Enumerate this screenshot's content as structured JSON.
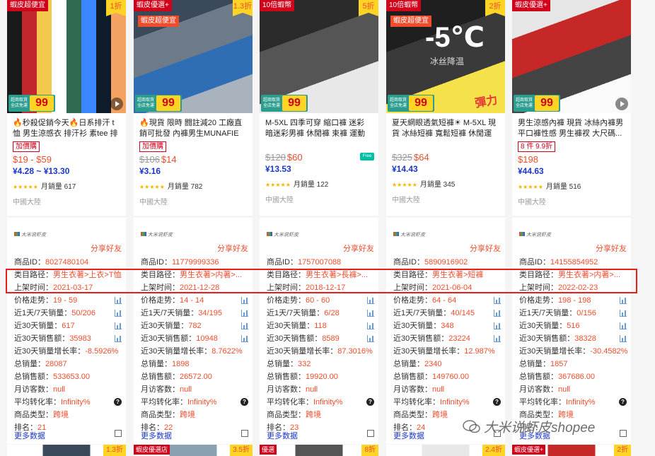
{
  "products": [
    {
      "tag": "蝦皮超便宜",
      "tag2": "",
      "discount": "1折",
      "title": "🔥秒殺促銷今天🔥日系排汗 t恤 男生涼感衣 排汗衫 素tee 排汗...",
      "badge": "加價購",
      "old_price": "",
      "price": "$19 - $59",
      "cny": "¥4.28 ~ ¥13.30",
      "sales": "月銷量 617",
      "origin": "中國大陸",
      "promo_label": "超商取貨 全店免運",
      "promo_num": "99",
      "play": true,
      "free": false,
      "thumb_colors": [
        "#1a1a1a",
        "#c1272d",
        "#f2c94c",
        "#ffffff",
        "#2d6a4f",
        "#3a86ff",
        "#0d1b2a",
        "#f4a261"
      ]
    },
    {
      "tag": "蝦皮優選+",
      "tag2": "蝦皮超便宜",
      "discount": "1.3折",
      "title": "🔥現貨 限時 闘註減20 工廠直銷可批發 內褲男生MUNAFIE凶...",
      "badge": "加價購",
      "old_price": "$106",
      "price": "$14",
      "cny": "¥3.16",
      "sales": "月銷量 782",
      "origin": "中國大陸",
      "promo_label": "超商取貨 全店免運",
      "promo_num": "99",
      "play": false,
      "free": false,
      "thumb_colors": [
        "#3b4a5a",
        "#6c7a89",
        "#2f6db5",
        "#a8b3bd"
      ]
    },
    {
      "tag": "10倍蝦幣",
      "tag2": "",
      "discount": "5折",
      "title": "M-5XL 四季可穿 縮口褲 迷彩 暗迷彩男褲 休閒褲 束褲 運動褲 ...",
      "badge": "",
      "old_price": "$120",
      "price": "$60",
      "cny": "¥13.53",
      "sales": "月銷量 122",
      "origin": "中國大陸",
      "promo_label": "超商取貨 全店免運",
      "promo_num": "99",
      "play": false,
      "free": true,
      "free_text": "Free",
      "thumb_colors": [
        "#2b2b2b",
        "#555555",
        "#e8e8e8"
      ]
    },
    {
      "tag": "10倍蝦幣",
      "tag2": "蝦皮超便宜",
      "discount": "2折",
      "title": "夏天網眼透氣短褲☀ M-5XL 現貨 冰絲短褲 寬鬆短褲 休閒運動...",
      "badge": "",
      "old_price": "$325",
      "price": "$64",
      "cny": "¥14.43",
      "sales": "月銷量 345",
      "origin": "中國大陸",
      "promo_label": "超商取貨 全店免運",
      "promo_num": "99",
      "play": false,
      "free": false,
      "overlay_big": "-5℃",
      "overlay_small": "冰丝降温",
      "overlay_badge": "彈力",
      "thumb_colors": [
        "#1f1f1f",
        "#3a3a3a",
        "#f5e14a"
      ]
    },
    {
      "tag": "蝦皮優選+",
      "tag2": "",
      "discount": "",
      "title": "男生涼感內褲 現貨 冰絲內褲男 平口褲性感 男生褲衩 大尺碼...",
      "badge": "8 件 9.9折",
      "old_price": "",
      "price": "$198",
      "cny": "¥44.63",
      "sales": "月銷量 516",
      "origin": "中國大陸",
      "promo_label": "超商取貨 全店免運",
      "promo_num": "99",
      "play": true,
      "free": false,
      "thumb_colors": [
        "#e6e6e6",
        "#c62828",
        "#444444",
        "#fafafa"
      ]
    }
  ],
  "panels": [
    {
      "logo": "大米说虾皮",
      "share": "分享好友",
      "id_label": "商品ID：",
      "id": "8027480104",
      "cat_label": "类目路径：",
      "cat": "男生衣著>上衣>T恤",
      "date_label": "上架时间：",
      "date": "2021-03-17",
      "price_trend_label": "价格走势：",
      "price_trend": "19 - 59",
      "s17_label": "近1天/7天销量：",
      "s17": "50/206",
      "s30_label": "近30天销量：",
      "s30": "617",
      "amt30_label": "近30天销售额：",
      "amt30": "35983",
      "growth_label": "近30天销量增长率：",
      "growth": "-8.5926%",
      "total_label": "总销量：",
      "total": "28087",
      "total_amt_label": "总销售额：",
      "total_amt": "533653.00",
      "visitors_label": "月访客数：",
      "visitors": "null",
      "conv_label": "平均转化率：",
      "conv": "Infinity%",
      "type_label": "商品类型：",
      "type": "跨境",
      "rank_label": "排名：",
      "rank": "21",
      "more": "更多数据"
    },
    {
      "logo": "大米说虾皮",
      "share": "分享好友",
      "id_label": "商品ID：",
      "id": "11779999336",
      "cat_label": "类目路径：",
      "cat": "男生衣著>内著>...",
      "date_label": "上架时间：",
      "date": "2021-12-28",
      "price_trend_label": "价格走势：",
      "price_trend": "14 - 14",
      "s17_label": "近1天/7天销量：",
      "s17": "34/195",
      "s30_label": "近30天销量：",
      "s30": "782",
      "amt30_label": "近30天销售额：",
      "amt30": "10948",
      "growth_label": "近30天销量增长率：",
      "growth": "8.7622%",
      "total_label": "总销量：",
      "total": "1898",
      "total_amt_label": "总销售额：",
      "total_amt": "26572.00",
      "visitors_label": "月访客数：",
      "visitors": "null",
      "conv_label": "平均转化率：",
      "conv": "Infinity%",
      "type_label": "商品类型：",
      "type": "跨境",
      "rank_label": "排名：",
      "rank": "22",
      "more": "更多数据"
    },
    {
      "logo": "大米说虾皮",
      "share": "分享好友",
      "id_label": "商品ID：",
      "id": "1757007088",
      "cat_label": "类目路径：",
      "cat": "男生衣著>長褲>...",
      "date_label": "上架时间：",
      "date": "2018-12-17",
      "price_trend_label": "价格走势：",
      "price_trend": "60 - 60",
      "s17_label": "近1天/7天销量：",
      "s17": "6/28",
      "s30_label": "近30天销量：",
      "s30": "118",
      "amt30_label": "近30天销售额：",
      "amt30": "8589",
      "growth_label": "近30天销量增长率：",
      "growth": "87.3016%",
      "total_label": "总销量：",
      "total": "332",
      "total_amt_label": "总销售额：",
      "total_amt": "19920.00",
      "visitors_label": "月访客数：",
      "visitors": "null",
      "conv_label": "平均转化率：",
      "conv": "Infinity%",
      "type_label": "商品类型：",
      "type": "跨境",
      "rank_label": "排名：",
      "rank": "23",
      "more": "更多数据"
    },
    {
      "logo": "大米说虾皮",
      "share": "分享好友",
      "id_label": "商品ID：",
      "id": "5890916902",
      "cat_label": "类目路径：",
      "cat": "男生衣著>短褲",
      "date_label": "上架时间：",
      "date": "2021-06-04",
      "price_trend_label": "价格走势：",
      "price_trend": "64 - 64",
      "s17_label": "近1天/7天销量：",
      "s17": "40/145",
      "s30_label": "近30天销量：",
      "s30": "348",
      "amt30_label": "近30天销售额：",
      "amt30": "23224",
      "growth_label": "近30天销量增长率：",
      "growth": "12.987%",
      "total_label": "总销量：",
      "total": "2340",
      "total_amt_label": "总销售额：",
      "total_amt": "149760.00",
      "visitors_label": "月访客数：",
      "visitors": "null",
      "conv_label": "平均转化率：",
      "conv": "Infinity%",
      "type_label": "商品类型：",
      "type": "跨境",
      "rank_label": "排名：",
      "rank": "24",
      "more": "更多数据"
    },
    {
      "logo": "大米说虾皮",
      "share": "分享好友",
      "id_label": "商品ID：",
      "id": "14155854952",
      "cat_label": "类目路径：",
      "cat": "男生衣著>内著>...",
      "date_label": "上架时间：",
      "date": "2022-02-23",
      "price_trend_label": "价格走势：",
      "price_trend": "198 - 198",
      "s17_label": "近1天/7天销量：",
      "s17": "0/156",
      "s30_label": "近30天销量：",
      "s30": "516",
      "amt30_label": "近30天销售额：",
      "amt30": "38328",
      "growth_label": "近30天销量增长率：",
      "growth": "-30.4582%",
      "total_label": "总销量：",
      "total": "1857",
      "total_amt_label": "总销售额：",
      "total_amt": "367686.00",
      "visitors_label": "月访客数：",
      "visitors": "null",
      "conv_label": "平均转化率：",
      "conv": "Infinity%",
      "type_label": "商品类型：",
      "type": "跨境",
      "rank_label": "排名：",
      "rank": "",
      "more": "更多数据"
    }
  ],
  "bottom_row": [
    {
      "tag": "",
      "discount": "1.3折"
    },
    {
      "tag": "蝦皮優選店",
      "discount": "3.5折"
    },
    {
      "tag": "優選",
      "discount": "8折"
    },
    {
      "tag": "",
      "discount": "2.4折"
    },
    {
      "tag": "蝦皮優選+",
      "discount": "2折"
    }
  ],
  "watermark": "大米说虾皮shopee",
  "colors": {
    "accent": "#ee4d2d",
    "cny": "#1a37c8",
    "highlight": "#e5201b"
  }
}
